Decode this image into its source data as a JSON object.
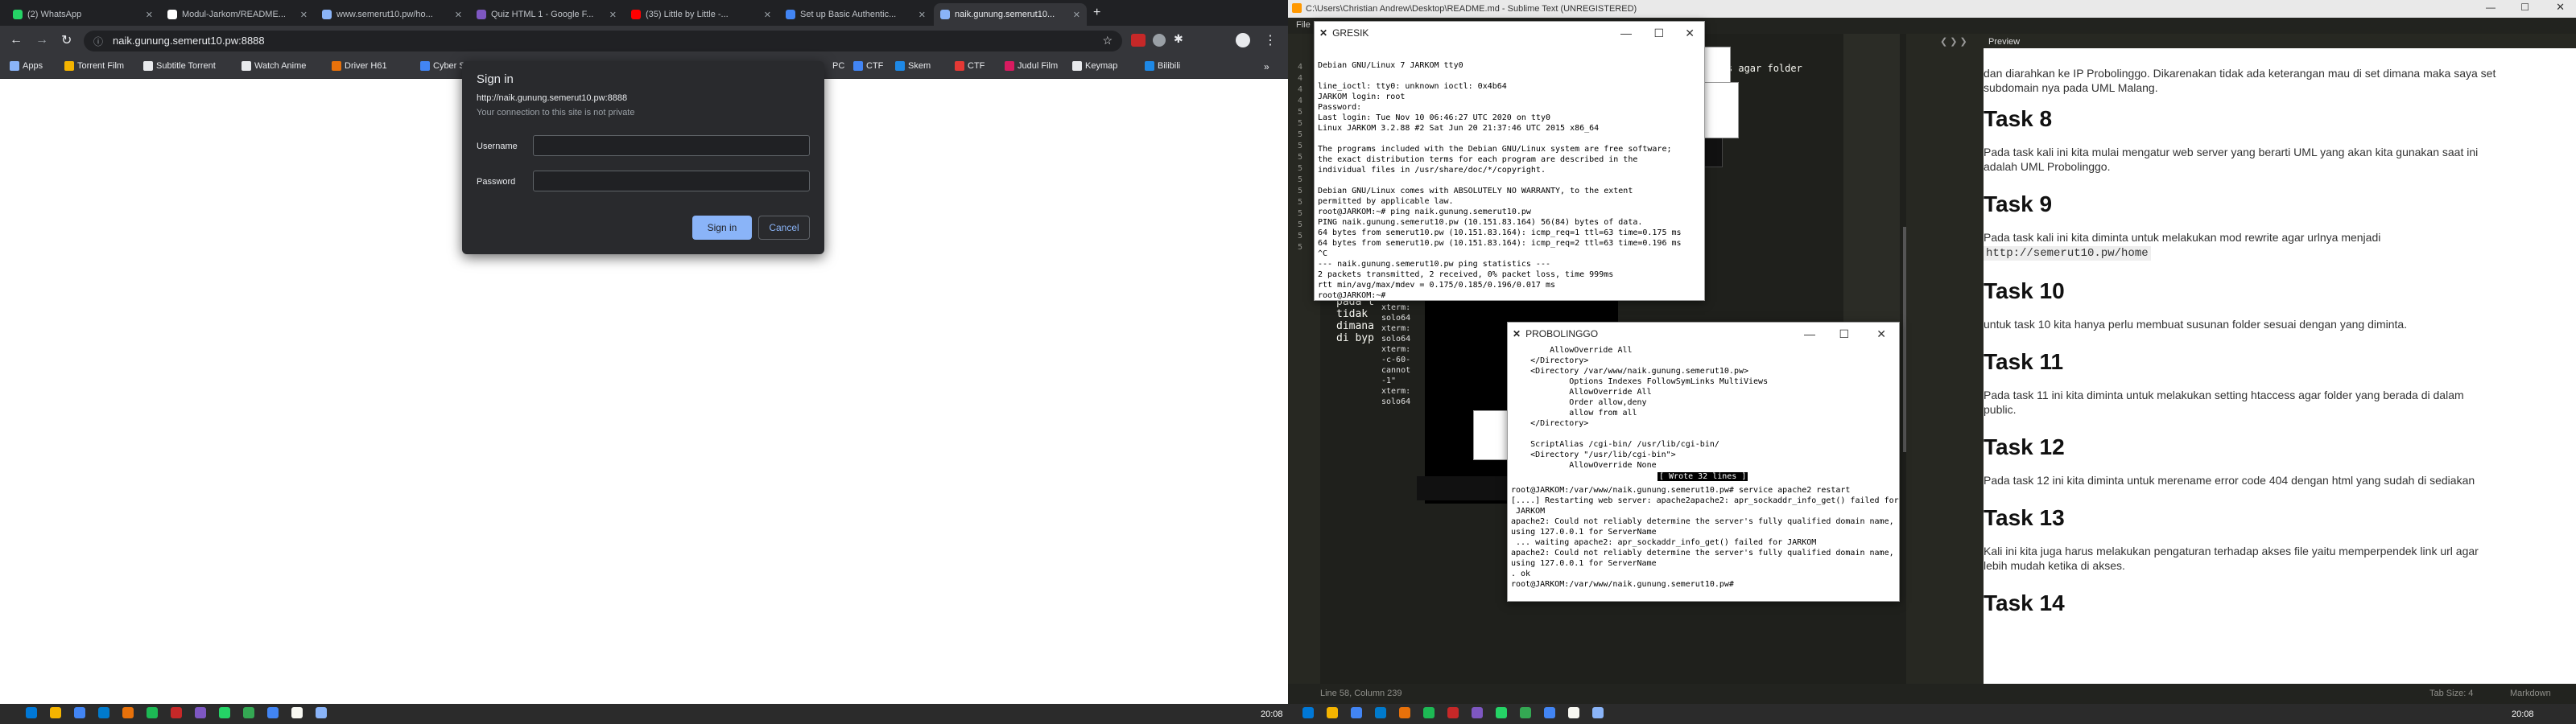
{
  "browser": {
    "tabs": [
      {
        "label": "(2) WhatsApp",
        "color": "#25d366"
      },
      {
        "label": "Modul-Jarkom/README...",
        "color": "#ffffff"
      },
      {
        "label": "www.semerut10.pw/ho...",
        "color": "#8ab4f8"
      },
      {
        "label": "Quiz HTML 1 - Google F...",
        "color": "#7e57c2"
      },
      {
        "label": "(35) Little by Little -...",
        "color": "#ff0000"
      },
      {
        "label": "Set up Basic Authentic...",
        "color": "#4285f4"
      },
      {
        "label": "naik.gunung.semerut10...",
        "color": "#8ab4f8"
      }
    ],
    "address": "naik.gunung.semerut10.pw:8888",
    "bookmarks": [
      {
        "label": "Apps",
        "color": "#8ab4f8"
      },
      {
        "label": "Torrent Film",
        "color": "#f4b400"
      },
      {
        "label": "Subtitle Torrent",
        "color": "#e8eaed"
      },
      {
        "label": "Watch Anime",
        "color": "#e8eaed"
      },
      {
        "label": "Driver H61",
        "color": "#e8710a"
      },
      {
        "label": "Cyber S",
        "color": "#4285f4"
      },
      {
        "label": "PC",
        "color": "#35363a"
      },
      {
        "label": "CTF",
        "color": "#4285f4"
      },
      {
        "label": "Skem",
        "color": "#1e88e5"
      },
      {
        "label": "CTF",
        "color": "#e53935"
      },
      {
        "label": "Judul Film",
        "color": "#d81b60"
      },
      {
        "label": "Keymap",
        "color": "#e8eaed"
      },
      {
        "label": "Bilibili",
        "color": "#1e88e5"
      }
    ],
    "dialog": {
      "title": "Sign in",
      "url": "http://naik.gunung.semerut10.pw:8888",
      "note": "Your connection to this site is not private",
      "username_label": "Username",
      "password_label": "Password",
      "signin": "Sign in",
      "cancel": "Cancel"
    }
  },
  "sublime": {
    "title": "C:\\Users\\Christian Andrew\\Desktop\\README.md - Sublime Text (UNREGISTERED)",
    "menu_file": "File",
    "editor_line": "ccess agar folder",
    "preview_tab": "Preview",
    "preview_intro": "dan diarahkan ke IP Probolinggo. Dikarenakan tidak ada keterangan mau di set dimana maka saya set subdomain nya pada UML Malang.",
    "tasks": [
      {
        "h": "Task 8",
        "p": "Pada task kali ini kita mulai mengatur web server yang berarti UML yang akan kita gunakan saat ini adalah UML Probolinggo."
      },
      {
        "h": "Task 9",
        "p": "Pada task kali ini kita diminta untuk melakukan mod rewrite agar urlnya menjadi",
        "code": "http://semerut10.pw/home"
      },
      {
        "h": "Task 10",
        "p": "untuk task 10 kita hanya perlu membuat susunan folder sesuai dengan yang diminta."
      },
      {
        "h": "Task 11",
        "p": "Pada task 11 ini kita diminta untuk melakukan setting htaccess agar folder yang berada di dalam public."
      },
      {
        "h": "Task 12",
        "p": "Pada task 12 ini kita diminta untuk merename error code 404 dengan html yang sudah di sediakan"
      },
      {
        "h": "Task 13",
        "p": "Kali ini kita juga harus melakukan pengaturan terhadap akses file yaitu memperpendek link url agar lebih mudah ketika di akses."
      },
      {
        "h": "Task 14",
        "p": ""
      }
    ],
    "status_left": "Line 58, Column 239",
    "status_tab": "Tab Size: 4",
    "status_syntax": "Markdown",
    "gutter": [
      "4",
      "4",
      "4",
      "4",
      "5",
      "5",
      "5",
      "5",
      "5",
      "5",
      "5",
      "5",
      "5",
      "5",
      "5",
      "5",
      "5"
    ],
    "bg_text": "pada t\ntidak \ndimana\ndi byp"
  },
  "gresik": {
    "title": "GRESIK",
    "text": "Debian GNU/Linux 7 JARKOM tty0\n\nline_ioctl: tty0: unknown ioctl: 0x4b64\nJARKOM login: root\nPassword:\nLast login: Tue Nov 10 06:46:27 UTC 2020 on tty0\nLinux JARKOM 3.2.88 #2 Sat Jun 20 21:37:46 UTC 2015 x86_64\n\nThe programs included with the Debian GNU/Linux system are free software;\nthe exact distribution terms for each program are described in the\nindividual files in /usr/share/doc/*/copyright.\n\nDebian GNU/Linux comes with ABSOLUTELY NO WARRANTY, to the extent\npermitted by applicable law.\nroot@JARKOM:~# ping naik.gunung.semerut10.pw\nPING naik.gunung.semerut10.pw (10.151.83.164) 56(84) bytes of data.\n64 bytes from semerut10.pw (10.151.83.164): icmp_req=1 ttl=63 time=0.175 ms\n64 bytes from semerut10.pw (10.151.83.164): icmp_req=2 ttl=63 time=0.196 ms\n^C\n--- naik.gunung.semerut10.pw ping statistics ---\n2 packets transmitted, 2 received, 0% packet loss, time 999ms\nrtt min/avg/max/mdev = 0.175/0.185/0.196/0.017 ms\nroot@JARKOM:~# "
  },
  "probolinggo": {
    "title": "PROBOLINGGO",
    "text": "        AllowOverride All\n    </Directory>\n    <Directory /var/www/naik.gunung.semerut10.pw>\n            Options Indexes FollowSymLinks MultiViews\n            AllowOverride All\n            Order allow,deny\n            allow from all\n    </Directory>\n\n    ScriptAlias /cgi-bin/ /usr/lib/cgi-bin/\n    <Directory \"/usr/lib/cgi-bin\">\n            AllowOverride None",
    "wrote": "[ Wrote 32 lines ]",
    "text2": "root@JARKOM:/var/www/naik.gunung.semerut10.pw# service apache2 restart\n[....] Restarting web server: apache2apache2: apr_sockaddr_info_get() failed for\n JARKOM\napache2: Could not reliably determine the server's fully qualified domain name,\nusing 127.0.0.1 for ServerName\n ... waiting apache2: apr_sockaddr_info_get() failed for JARKOM\napache2: Could not reliably determine the server's fully qualified domain name,\nusing 127.0.0.1 for ServerName\n. ok\nroot@JARKOM:/var/www/naik.gunung.semerut10.pw# "
  },
  "xterm_bg": "xterm:\nsolo64\nxterm:\nsolo64\nxterm:\n-c-60-\ncannot\n-1\"\nxterm:\nsolo64",
  "taskbar": {
    "clock_left": "20:08",
    "clock_right": "20:08",
    "icon_colors": [
      "#0078d7",
      "#f4b400",
      "#4285f4",
      "#007acc",
      "#e8710a",
      "#1db954",
      "#c62828",
      "#7e57c2",
      "#25d366",
      "#34a853",
      "#4285f4",
      "#f8f8f2",
      "#8ab4f8"
    ]
  }
}
